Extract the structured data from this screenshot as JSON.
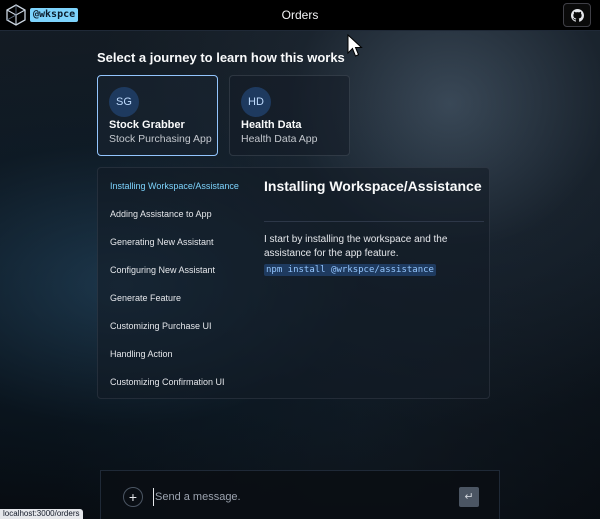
{
  "header": {
    "brand": "@wkspce",
    "title": "Orders"
  },
  "main": {
    "prompt": "Select a journey to learn how this works",
    "journeys": [
      {
        "initials": "SG",
        "name": "Stock Grabber",
        "description": "Stock Purchasing App"
      },
      {
        "initials": "HD",
        "name": "Health Data",
        "description": "Health Data App"
      }
    ],
    "steps": [
      "Installing Workspace/Assistance",
      "Adding Assistance to App",
      "Generating New Assistant",
      "Configuring New Assistant",
      "Generate Feature",
      "Customizing Purchase UI",
      "Handling Action",
      "Customizing Confirmation UI"
    ],
    "detail": {
      "title": "Installing Workspace/Assistance",
      "body": "I start by installing the workspace and the assistance for the app feature.",
      "code": "npm install @wrkspce/assistance"
    }
  },
  "chat": {
    "placeholder": "Send a message.",
    "plus": "+",
    "send": "↵"
  },
  "status": {
    "url": "localhost:3000/orders"
  },
  "colors": {
    "accent": "#7dd3fc",
    "active_border": "#93c5fd",
    "code_bg": "#1e3a5f"
  }
}
